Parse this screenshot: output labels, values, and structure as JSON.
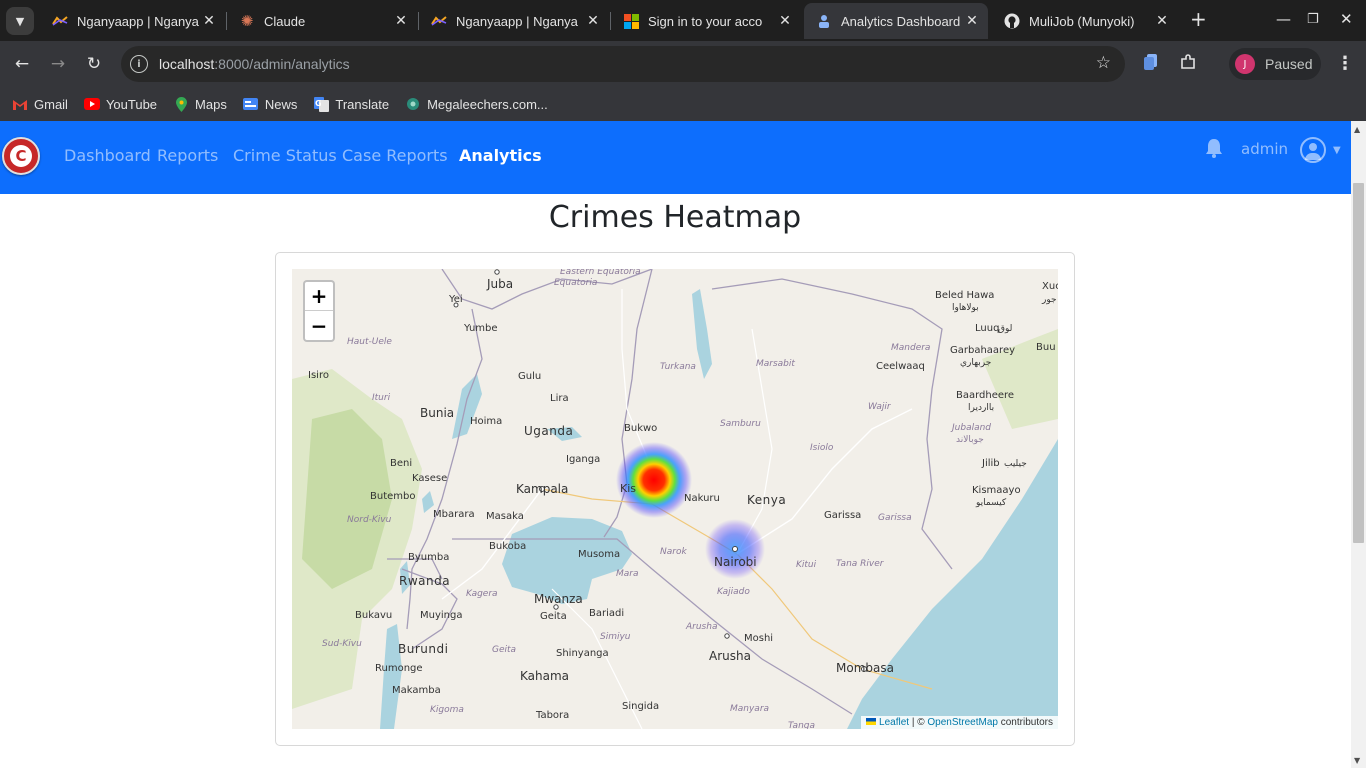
{
  "browser": {
    "tabs": [
      {
        "title": "Nganyaapp | Nganya",
        "icon": "nganya-icon"
      },
      {
        "title": "Claude",
        "icon": "claude-icon"
      },
      {
        "title": "Nganyaapp | Nganya",
        "icon": "nganya-icon"
      },
      {
        "title": "Sign in to your acco",
        "icon": "microsoft-icon"
      },
      {
        "title": "Analytics Dashboard",
        "icon": "page-icon",
        "active": true
      },
      {
        "title": "MuliJob (Munyoki)",
        "icon": "github-icon"
      }
    ],
    "url_host": "localhost",
    "url_rest": ":8000/admin/analytics",
    "profile_initial": "J",
    "profile_status": "Paused",
    "bookmarks": [
      {
        "label": "Gmail",
        "icon": "gmail-icon"
      },
      {
        "label": "YouTube",
        "icon": "youtube-icon"
      },
      {
        "label": "Maps",
        "icon": "maps-icon"
      },
      {
        "label": "News",
        "icon": "news-icon"
      },
      {
        "label": "Translate",
        "icon": "translate-icon"
      },
      {
        "label": "Megaleechers.com...",
        "icon": "megaleechers-icon"
      }
    ]
  },
  "navbar": {
    "brand_letter": "C",
    "links": [
      "Dashboard",
      "Reports",
      "Crime Status",
      "Case Reports",
      "Analytics"
    ],
    "active": "Analytics",
    "user": "admin",
    "colors": {
      "bg": "#0d6efd"
    }
  },
  "page": {
    "title": "Crimes Heatmap"
  },
  "map": {
    "zoom_in": "+",
    "zoom_out": "−",
    "attribution": {
      "leaflet": "Leaflet",
      "sep": " | © ",
      "osm": "OpenStreetMap",
      "tail": " contributors"
    },
    "labels": {
      "juba": "Juba",
      "eastern_equatoria": "Eastern Equatoria",
      "yei": "Yei",
      "yumbe": "Yumbe",
      "haut_uele": "Haut-Uele",
      "isiro": "Isiro",
      "gulu": "Gulu",
      "lira": "Lira",
      "ituri": "Ituri",
      "bunia": "Bunia",
      "hoima": "Hoima",
      "uganda": "Uganda",
      "bukwo": "Bukwo",
      "iganga": "Iganga",
      "beni": "Beni",
      "kasese": "Kasese",
      "butembo": "Butembo",
      "kampala": "Kampala",
      "kisumu_partial": "Kis",
      "nakuru": "Nakuru",
      "kenya": "Kenya",
      "mbarara": "Mbarara",
      "masaka": "Masaka",
      "nord_kivu": "Nord-Kivu",
      "bukoba": "Bukoba",
      "musoma": "Musoma",
      "narok": "Narok",
      "nairobi": "Nairobi",
      "byumba": "Byumba",
      "rwanda": "Rwanda",
      "mara": "Mara",
      "kajiado": "Kajiado",
      "kagera": "Kagera",
      "mwanza": "Mwanza",
      "bukavu": "Bukavu",
      "muyinga": "Muyinga",
      "geita": "Geita",
      "bariadi": "Bariadi",
      "sud_kivu": "Sud-Kivu",
      "simiyu": "Simiyu",
      "arusha_region": "Arusha",
      "moshi": "Moshi",
      "burundi": "Burundi",
      "geita_region": "Geita",
      "shinyanga": "Shinyanga",
      "arusha": "Arusha",
      "rumonge": "Rumonge",
      "mombasa": "Mombasa",
      "kahama": "Kahama",
      "makamba": "Makamba",
      "kigoma": "Kigoma",
      "singida": "Singida",
      "manyara": "Manyara",
      "tabora": "Tabora",
      "tanga": "Tanga",
      "turkana": "Turkana",
      "marsabit": "Marsabit",
      "samburu": "Samburu",
      "isiolo": "Isiolo",
      "garissa": "Garissa",
      "garissa_region": "Garissa",
      "kitui": "Kitui",
      "tana_river": "Tana River",
      "wajir": "Wajir",
      "mandera": "Mandera",
      "beled_hawa": "Beled Hawa",
      "beled_hawa_ar": "بولاهاوا",
      "luuq": "Luuq",
      "luuq_ar": "لوق",
      "garbahaarey": "Garbahaarey",
      "garbahaarey_ar": "جربهاري",
      "ceelwaaq": "Ceelwaaq",
      "baardheere": "Baardheere",
      "baardheere_ar": "باارديرا",
      "jubaland": "Jubaland",
      "jubaland_ar": "جوبالاند",
      "jilib": "Jilib",
      "jilib_ar": "جيليب",
      "kismaayo": "Kismaayo",
      "kismaayo_ar": "كيسمايو",
      "bu_partial": "Buu",
      "xu_partial": "Xuc",
      "xu_ar_partial": "جور"
    },
    "hotspots": [
      {
        "place": "Kisumu",
        "intensity": 1.0
      },
      {
        "place": "Nairobi",
        "intensity": 0.3
      }
    ]
  }
}
